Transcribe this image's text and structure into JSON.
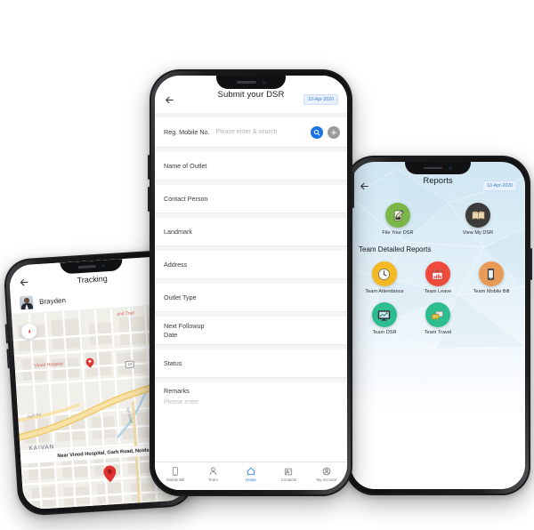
{
  "meta": {
    "scene": "Three mobile phone mockups showing a field-sales DSR app"
  },
  "center_phone": {
    "screen_name": "Submit your DSR",
    "header": {
      "back_icon": "back-arrow-icon",
      "title": "Submit your DSR",
      "date_badge": "10-Apr-2020"
    },
    "search_row": {
      "label": "Reg. Mobile No.",
      "placeholder": "Please enter & search",
      "value": "",
      "search_icon": "search-icon",
      "add_icon": "plus-icon",
      "search_button_color": "#1a73e8",
      "add_button_color": "#9b9b9b"
    },
    "fields": [
      {
        "label": "Name of Outlet",
        "value": ""
      },
      {
        "label": "Contact Person",
        "value": ""
      },
      {
        "label": "Landmark",
        "value": ""
      },
      {
        "label": "Address",
        "value": ""
      },
      {
        "label": "Outlet Type",
        "value": ""
      },
      {
        "label": "Next Followup\nDate",
        "value": ""
      },
      {
        "label": "Status",
        "value": ""
      }
    ],
    "remarks": {
      "label": "Remarks",
      "placeholder": "Please enter",
      "value": ""
    },
    "tabs": [
      {
        "label": "Mobile Bill",
        "icon": "mobile-bill-icon",
        "active": false
      },
      {
        "label": "Team",
        "icon": "team-icon",
        "active": false
      },
      {
        "label": "Home",
        "icon": "home-icon",
        "active": true
      },
      {
        "label": "Contacts",
        "icon": "contacts-icon",
        "active": false
      },
      {
        "label": "My Account",
        "icon": "my-account-icon",
        "active": false
      }
    ],
    "active_tab_color": "#1a73e8"
  },
  "left_phone": {
    "screen_name": "Tracking",
    "header": {
      "back_icon": "back-arrow-icon",
      "title": "Tracking"
    },
    "user": {
      "name": "Brayden",
      "avatar": "user-avatar"
    },
    "map": {
      "compass_icon": "compass-icon",
      "hospital_label": "Vinod Hospital",
      "hospital_marker": "hospital-pin-icon",
      "street_label": "Garh Rd",
      "street_label_2": "NH Sarak",
      "top_label": "and Trad",
      "district_label": "KAIVAN",
      "highway_shield": "14",
      "callout": "Near Vinod Hospital, Garh Road, Noida",
      "location_pin": "location-pin-icon",
      "pin_color": "#e03131",
      "road_color": "#f6d98a"
    }
  },
  "right_phone": {
    "screen_name": "Reports",
    "header": {
      "back_icon": "back-arrow-icon",
      "title": "Reports",
      "date_badge": "10-Apr-2020"
    },
    "top_actions": [
      {
        "label": "File Your DSR",
        "icon": "notepad-pencil-icon",
        "color": "#7ab648"
      },
      {
        "label": "View My DSR",
        "icon": "open-book-icon",
        "color": "#3b3b3b"
      }
    ],
    "section_title": "Team Detailed Reports",
    "reports": [
      {
        "label": "Team Attendance",
        "icon": "clock-icon",
        "color": "#f5b923"
      },
      {
        "label": "Team Leave",
        "icon": "calendar-icon",
        "color": "#ef4a3c"
      },
      {
        "label": "Team Mobile Bill",
        "icon": "smartphone-icon",
        "color": "#e89a56"
      },
      {
        "label": "Team DSR",
        "icon": "monitor-chart-icon",
        "color": "#2ebd8e"
      },
      {
        "label": "Team Travel",
        "icon": "travel-card-icon",
        "color": "#2ebd8e"
      }
    ]
  }
}
